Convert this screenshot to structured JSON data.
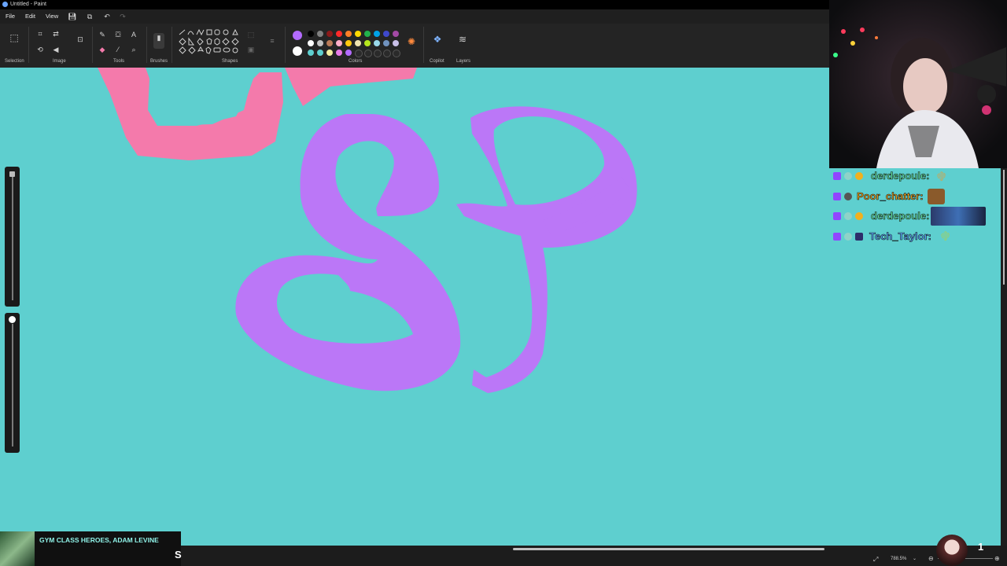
{
  "window": {
    "title": "Untitled - Paint"
  },
  "menu": {
    "items": [
      "File",
      "Edit",
      "View"
    ]
  },
  "ribbon": {
    "groups": {
      "selection": "Selection",
      "image": "Image",
      "tools": "Tools",
      "brushes": "Brushes",
      "shapes": "Shapes",
      "colors": "Colors",
      "copilot": "Copilot",
      "layers": "Layers"
    },
    "primary_color": "#b36bff",
    "secondary_color": "#ffffff"
  },
  "palette": {
    "row1": [
      "#000000",
      "#808080",
      "#8b1a1a",
      "#ff2a2a",
      "#ff7f27",
      "#ffd800",
      "#22b14c",
      "#00a2e8",
      "#3f48cc",
      "#a349a4"
    ],
    "row2": [
      "#ffffff",
      "#c3c3c3",
      "#b97a57",
      "#ffaec9",
      "#ffc90e",
      "#efe4b0",
      "#b5e61d",
      "#99d9ea",
      "#7092be",
      "#c8bfe7"
    ],
    "row3": [
      "#5ecfcf",
      "#5ecfcf",
      "#f6f0a0",
      "#e87ce8",
      "#b36bff",
      "#2a2a2a",
      "#2a2a2a",
      "#2a2a2a",
      "#2a2a2a",
      "#2a2a2a"
    ]
  },
  "canvas": {
    "background": "#5ecfcf",
    "pink": "#f47aab",
    "purple": "#bb77f7"
  },
  "chat": {
    "messages": [
      {
        "user": "derdepoule:",
        "color": "#63e6a0",
        "emote": "small"
      },
      {
        "user": "Poor_chatter:",
        "color": "#f2a31b",
        "emote": "dog"
      },
      {
        "user": "derdepoule:",
        "color": "#63e6a0",
        "emote": "image"
      },
      {
        "user": "Tech_Taylor:",
        "color": "#5aa9ff",
        "emote": "small"
      }
    ]
  },
  "now_playing": {
    "title": "GYM CLASS HEROES, ADAM LEVINE",
    "subtitle": "S"
  },
  "status_bar": {
    "zoom": "788.5%",
    "overlay_count": "1"
  }
}
